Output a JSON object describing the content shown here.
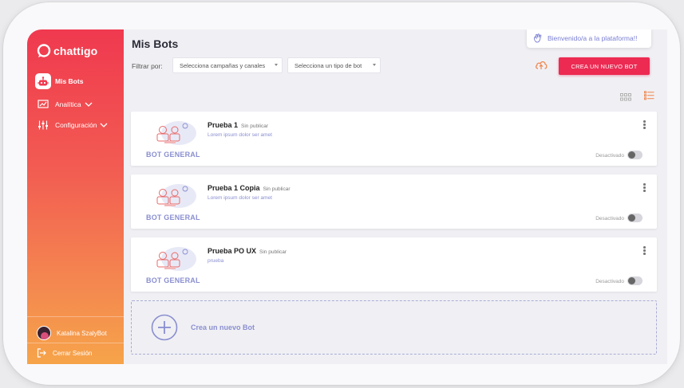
{
  "app": {
    "logo_text": "chattigo"
  },
  "sidebar": {
    "items": [
      {
        "label": "Mis Bots",
        "icon": "robot-icon"
      },
      {
        "label": "Analítica",
        "icon": "chart-icon"
      },
      {
        "label": "Configuración",
        "icon": "sliders-icon"
      }
    ],
    "user_name": "Katalina SzalyBot",
    "logout_label": "Cerrar Sesión"
  },
  "header": {
    "title": "Mis Bots",
    "welcome": "Bienvenido/a a la plataforma!!",
    "filter_label": "Filtrar por:",
    "filter_campaigns_placeholder": "Selecciona campañas y canales",
    "filter_type_placeholder": "Selecciona un tipo de bot",
    "create_button": "CREA UN NUEVO BOT"
  },
  "bots": [
    {
      "name": "Prueba 1",
      "status": "Sin publicar",
      "description": "Lorem ipsum dolor ser amet",
      "type": "BOT GENERAL",
      "toggle_label": "Desactivado",
      "active": false
    },
    {
      "name": "Prueba 1 Copia",
      "status": "Sin publicar",
      "description": "Lorem ipsum dolor ser amet",
      "type": "BOT GENERAL",
      "toggle_label": "Desactivado",
      "active": false
    },
    {
      "name": "Prueba PO UX",
      "status": "Sin publicar",
      "description": "prueba",
      "type": "BOT GENERAL",
      "toggle_label": "Desactivado",
      "active": false
    }
  ],
  "new_bot_label": "Crea un nuevo Bot",
  "colors": {
    "accent": "#ec2a52",
    "sidebar_top": "#f0394f",
    "sidebar_bottom": "#f6a44a",
    "muted_purple": "#8a8fd0"
  }
}
